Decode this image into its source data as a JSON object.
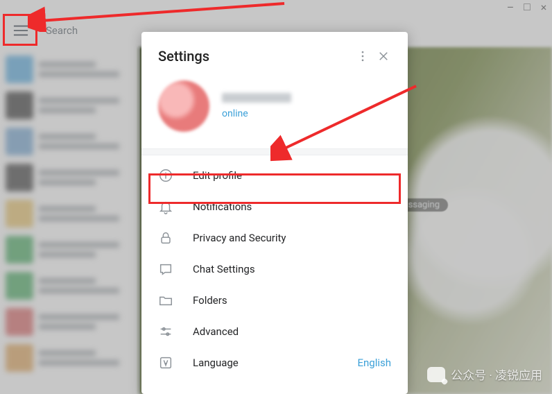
{
  "window": {
    "minimize": "–",
    "maximize": "□",
    "close": "×"
  },
  "topbar": {
    "search_placeholder": "Search"
  },
  "main": {
    "hint_badge": "ssaging"
  },
  "settings": {
    "title": "Settings",
    "profile": {
      "status": "online"
    },
    "menu": [
      {
        "key": "edit-profile",
        "label": "Edit profile",
        "icon": "info"
      },
      {
        "key": "notifications",
        "label": "Notifications",
        "icon": "bell"
      },
      {
        "key": "privacy",
        "label": "Privacy and Security",
        "icon": "lock"
      },
      {
        "key": "chat-settings",
        "label": "Chat Settings",
        "icon": "chat"
      },
      {
        "key": "folders",
        "label": "Folders",
        "icon": "folder"
      },
      {
        "key": "advanced",
        "label": "Advanced",
        "icon": "sliders"
      },
      {
        "key": "language",
        "label": "Language",
        "icon": "language",
        "right": "English"
      }
    ]
  },
  "watermark": "公众号 · 凌锐应用",
  "colors": {
    "accent": "#3ba0d8",
    "highlight": "#ee2a2b"
  }
}
